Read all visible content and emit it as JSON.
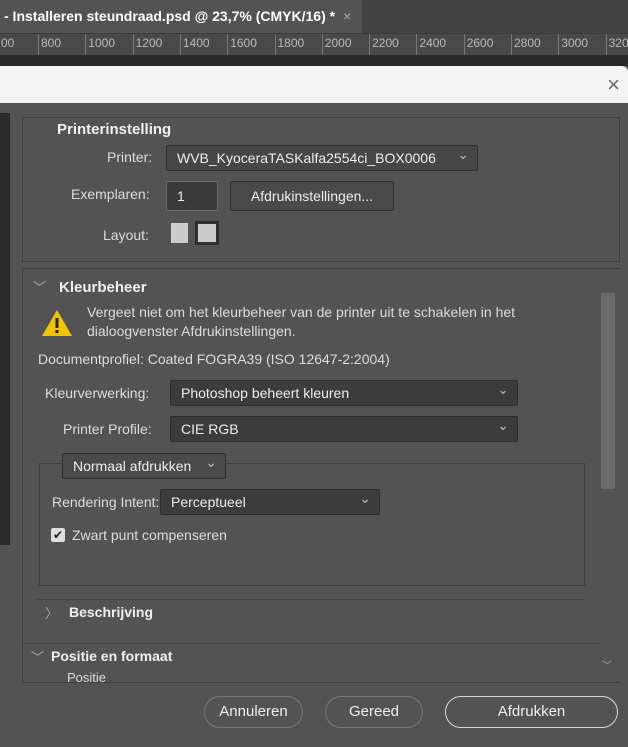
{
  "tab": {
    "title": "- Installeren steundraad.psd @ 23,7% (CMYK/16) *",
    "close": "×"
  },
  "ruler": [
    "00",
    "800",
    "1000",
    "1200",
    "1400",
    "1600",
    "1800",
    "2000",
    "2200",
    "2400",
    "2600",
    "2800",
    "3000",
    "320"
  ],
  "dialog": {
    "close": "×",
    "printer_section": {
      "title": "Printerinstelling",
      "printer_label": "Printer:",
      "printer_value": "WVB_KyoceraTASKalfa2554ci_BOX0006",
      "copies_label": "Exemplaren:",
      "copies_value": "1",
      "print_settings_button": "Afdrukinstellingen...",
      "layout_label": "Layout:"
    },
    "color_section": {
      "title": "Kleurbeheer",
      "warning": "Vergeet niet om het kleurbeheer van de printer uit te schakelen in het dialoogvenster Afdrukinstellingen.",
      "doc_profile": "Documentprofiel: Coated FOGRA39 (ISO 12647-2:2004)",
      "handling_label": "Kleurverwerking:",
      "handling_value": "Photoshop beheert kleuren",
      "profile_label": "Printer Profile:",
      "profile_value": "CIE RGB",
      "mode_value": "Normaal afdrukken",
      "intent_label": "Rendering Intent:",
      "intent_value": "Perceptueel",
      "bpc_label": "Zwart punt compenseren",
      "bpc_checked": true
    },
    "description_section": {
      "title": "Beschrijving"
    },
    "position_section": {
      "title": "Positie en formaat",
      "sub": "Positie"
    },
    "buttons": {
      "cancel": "Annuleren",
      "done": "Gereed",
      "print": "Afdrukken"
    }
  }
}
